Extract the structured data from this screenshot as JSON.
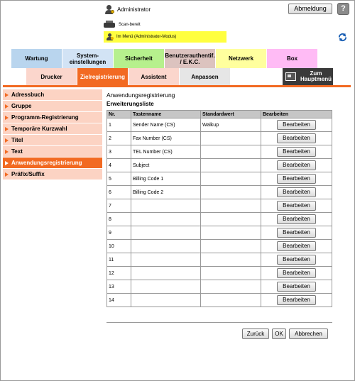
{
  "header": {
    "user_label": "Administrator",
    "logout_label": "Abmeldung",
    "help_label": "?",
    "status_text": "Scan-bereit",
    "mode_text": "Im Menü (Administrator-Modus)"
  },
  "main_tabs": [
    {
      "label": "Wartung",
      "color": "#b9d5ee"
    },
    {
      "label": "System-\neinstellungen",
      "color": "#d2e3f5"
    },
    {
      "label": "Sicherheit",
      "color": "#b6f08d"
    },
    {
      "label": "Benutzerauthentif. / E.K.C.",
      "color": "#dcc3bf"
    },
    {
      "label": "Netzwerk",
      "color": "#ffff9e"
    },
    {
      "label": "Box",
      "color": "#ffbbf5"
    }
  ],
  "sub_tabs": [
    {
      "label": "Drucker",
      "state": "normal"
    },
    {
      "label": "Zielregistrierung",
      "state": "active"
    },
    {
      "label": "Assistent",
      "state": "normal"
    },
    {
      "label": "Anpassen",
      "state": "grey"
    }
  ],
  "home_button": {
    "label": "Zum Hauptmenü"
  },
  "sidebar": {
    "items": [
      {
        "label": "Adressbuch",
        "active": false
      },
      {
        "label": "Gruppe",
        "active": false
      },
      {
        "label": "Programm-Registrierung",
        "active": false
      },
      {
        "label": "Temporäre Kurzwahl",
        "active": false
      },
      {
        "label": "Titel",
        "active": false
      },
      {
        "label": "Text",
        "active": false
      },
      {
        "label": "Anwendungsregistrierung",
        "active": true
      },
      {
        "label": "Präfix/Suffix",
        "active": false
      }
    ]
  },
  "content": {
    "title": "Anwendungsregistrierung",
    "subtitle": "Erweiterungsliste",
    "columns": [
      "Nr.",
      "Tastenname",
      "Standardwert",
      "Bearbeiten"
    ],
    "edit_label": "Bearbeiten",
    "rows": [
      {
        "nr": "1",
        "key": "Sender Name (CS)",
        "default": "Walkup"
      },
      {
        "nr": "2",
        "key": "Fax Number (CS)",
        "default": ""
      },
      {
        "nr": "3",
        "key": "TEL Number (CS)",
        "default": ""
      },
      {
        "nr": "4",
        "key": "Subject",
        "default": ""
      },
      {
        "nr": "5",
        "key": "Billing Code 1",
        "default": ""
      },
      {
        "nr": "6",
        "key": "Billing Code 2",
        "default": ""
      },
      {
        "nr": "7",
        "key": "",
        "default": ""
      },
      {
        "nr": "8",
        "key": "",
        "default": ""
      },
      {
        "nr": "9",
        "key": "",
        "default": ""
      },
      {
        "nr": "10",
        "key": "",
        "default": ""
      },
      {
        "nr": "11",
        "key": "",
        "default": ""
      },
      {
        "nr": "12",
        "key": "",
        "default": ""
      },
      {
        "nr": "13",
        "key": "",
        "default": ""
      },
      {
        "nr": "14",
        "key": "",
        "default": ""
      }
    ]
  },
  "footer": {
    "back_label": "Zurück",
    "ok_label": "OK",
    "cancel_label": "Abbrechen"
  }
}
